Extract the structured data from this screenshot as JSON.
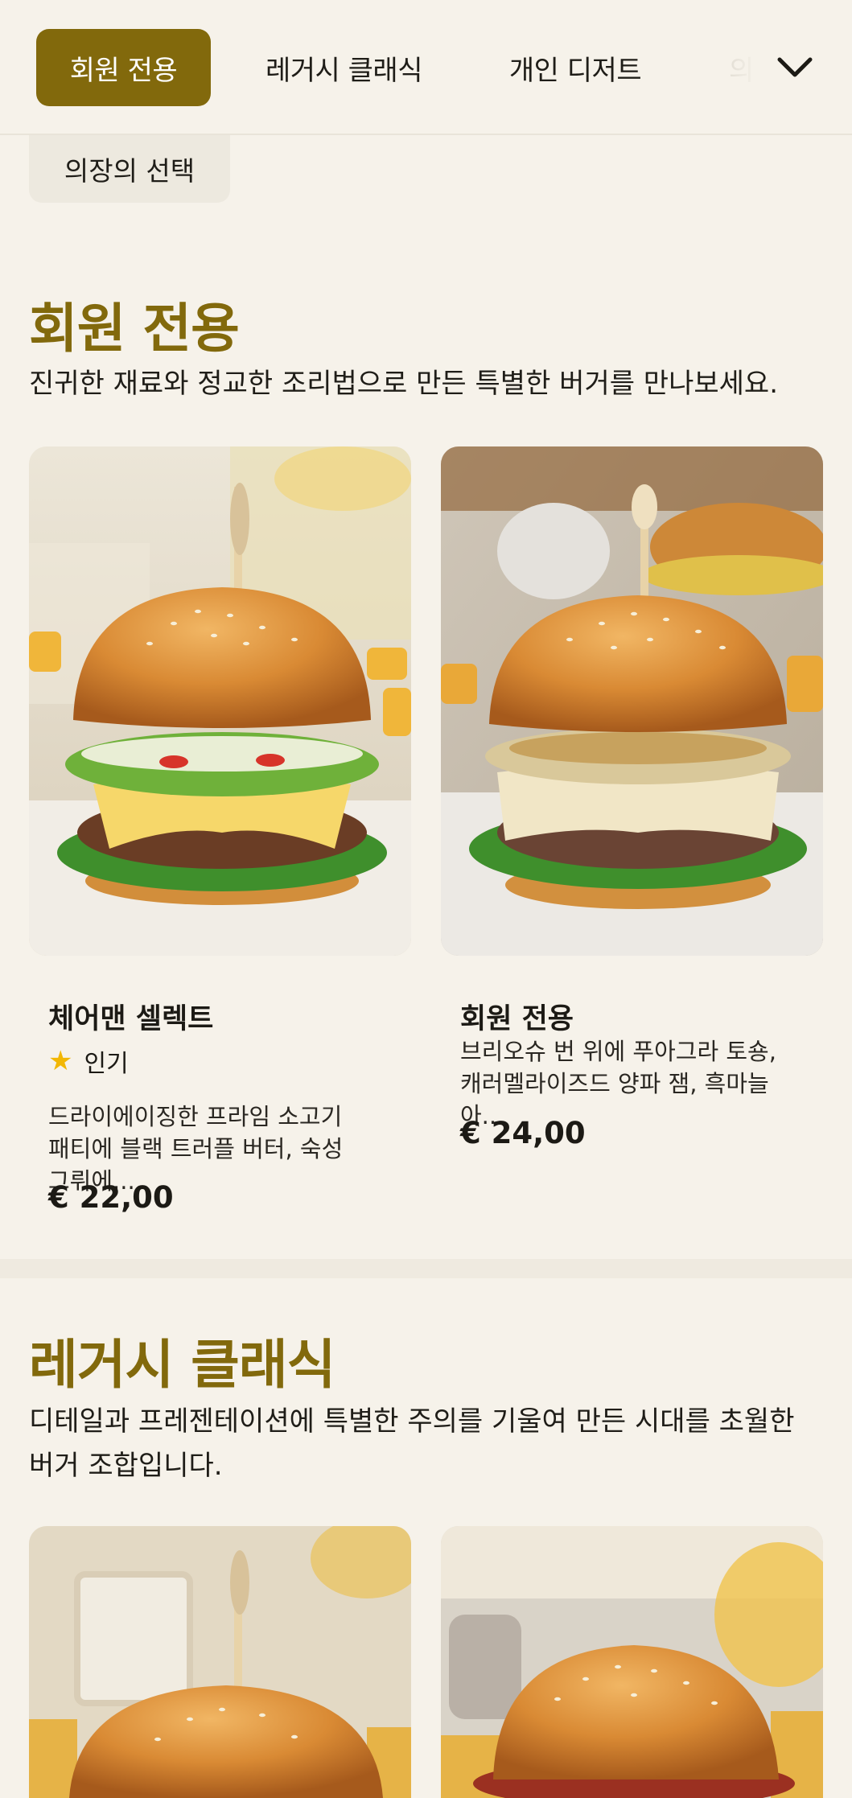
{
  "categories": [
    {
      "label": "회원 전용",
      "active": true
    },
    {
      "label": "레거시 클래식",
      "active": false
    },
    {
      "label": "개인 디저트",
      "active": false
    },
    {
      "label": "의",
      "active": false
    }
  ],
  "categories_row2": [
    {
      "label": "의장의 선택"
    }
  ],
  "icons": {
    "expand": "chevron-down-icon",
    "popular": "star-icon"
  },
  "colors": {
    "accent": "#82690c",
    "background": "#f6f2ea",
    "star": "#f2b705"
  },
  "sections": [
    {
      "title": "회원 전용",
      "description": "진귀한 재료와 정교한 조리법으로 만든 특별한 버거를 만나보세요.",
      "items": [
        {
          "name": "체어맨 셀렉트",
          "badge": "인기",
          "description": "드라이에이징한 프라임 소고기 패티에 블랙 트러플 버터, 숙성 그뤼에...",
          "price": "€ 22,00"
        },
        {
          "name": "회원 전용",
          "description": "브리오슈 번 위에 푸아그라 토숑, 캐러멜라이즈드 양파 잼, 흑마늘 아...",
          "price": "€ 24,00"
        }
      ]
    },
    {
      "title": "레거시 클래식",
      "description": "디테일과 프레젠테이션에 특별한 주의를 기울여 만든 시대를 초월한 버거 조합입니다."
    }
  ]
}
